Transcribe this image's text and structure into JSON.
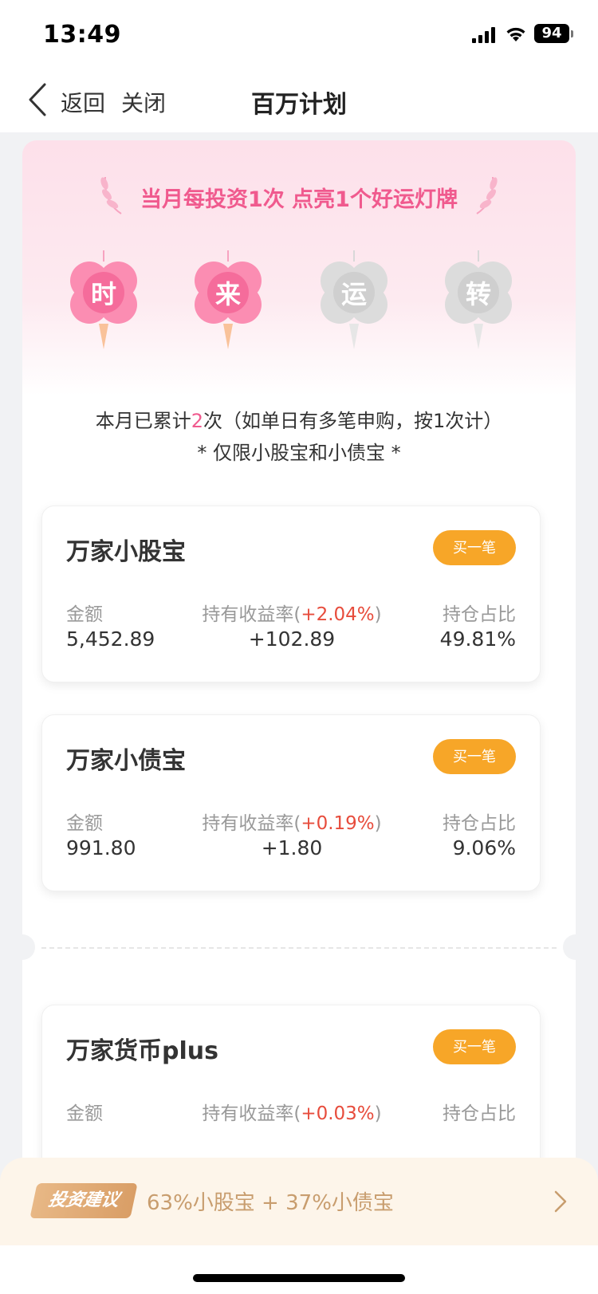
{
  "status": {
    "time": "13:49",
    "battery": "94"
  },
  "nav": {
    "back": "返回",
    "close": "关闭",
    "title": "百万计划"
  },
  "banner": {
    "headline": "当月每投资1次 点亮1个好运灯牌",
    "clovers": [
      {
        "char": "时",
        "lit": true
      },
      {
        "char": "来",
        "lit": true
      },
      {
        "char": "运",
        "lit": false
      },
      {
        "char": "转",
        "lit": false
      }
    ],
    "info_prefix": "本月已累计",
    "info_count": "2",
    "info_suffix": "次（如单日有多笔申购，按1次计）",
    "note": "* 仅限小股宝和小债宝 *"
  },
  "funds": [
    {
      "name": "万家小股宝",
      "buy": "买一笔",
      "amount_label": "金额",
      "amount": "5,452.89",
      "rate_label": "持有收益率(",
      "rate": "+2.04%",
      "rate_close": ")",
      "profit": "+102.89",
      "ratio_label": "持仓占比",
      "ratio": "49.81%"
    },
    {
      "name": "万家小债宝",
      "buy": "买一笔",
      "amount_label": "金额",
      "amount": "991.80",
      "rate_label": "持有收益率(",
      "rate": "+0.19%",
      "rate_close": ")",
      "profit": "+1.80",
      "ratio_label": "持仓占比",
      "ratio": "9.06%"
    },
    {
      "name": "万家货币plus",
      "buy": "买一笔",
      "amount_label": "金额",
      "rate_label": "持有收益率(",
      "rate": "+0.03%",
      "rate_close": ")",
      "ratio_label": "持仓占比"
    }
  ],
  "advice": {
    "tag": "投资建议",
    "text": "63%小股宝 + 37%小债宝"
  },
  "colors": {
    "pink": "#f05a8e",
    "orange": "#f7a628",
    "red": "#e74c3c",
    "gold": "#c89d6e"
  }
}
